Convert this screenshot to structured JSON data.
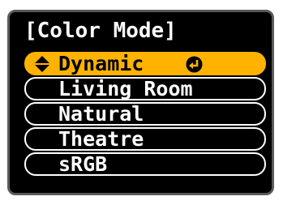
{
  "menu": {
    "title": "[Color Mode]",
    "options": [
      {
        "label": "Dynamic",
        "selected": true
      },
      {
        "label": "Living Room",
        "selected": false
      },
      {
        "label": "Natural",
        "selected": false
      },
      {
        "label": "Theatre",
        "selected": false
      },
      {
        "label": "sRGB",
        "selected": false
      }
    ],
    "selected_icons": [
      "up-down-arrows-icon",
      "enter-icon"
    ]
  },
  "colors": {
    "background": "#000000",
    "highlight": "#ffb300",
    "text": "#ffffff",
    "selected_text": "#000000"
  }
}
